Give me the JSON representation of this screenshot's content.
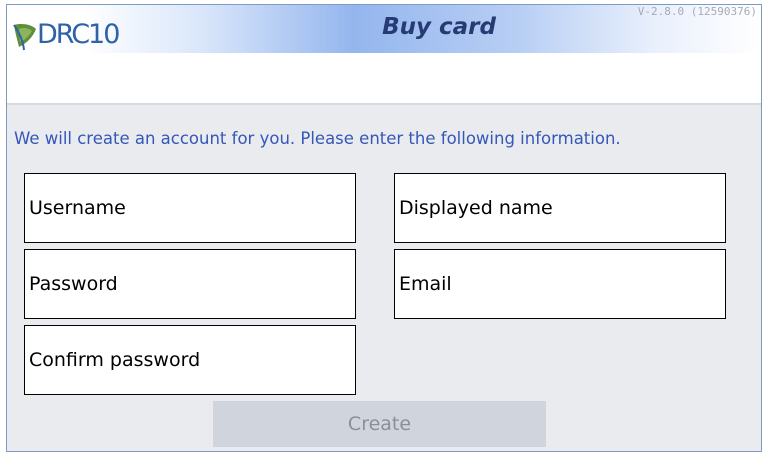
{
  "header": {
    "logo_text": "DRC10",
    "title": "Buy card",
    "version": "V-2.8.0 (12590376)"
  },
  "instructions": "We will create an account for you. Please enter the following information.",
  "form": {
    "username": {
      "placeholder": "Username"
    },
    "displayed_name": {
      "placeholder": "Displayed name"
    },
    "password": {
      "placeholder": "Password"
    },
    "email": {
      "placeholder": "Email"
    },
    "confirm_password": {
      "placeholder": "Confirm password"
    }
  },
  "actions": {
    "create_label": "Create",
    "create_enabled": false
  },
  "colors": {
    "brand": "#2e63a8",
    "title": "#263b73",
    "instructions": "#3557b8",
    "background": "#e9ebee",
    "button_disabled": "#d0d5dd"
  }
}
